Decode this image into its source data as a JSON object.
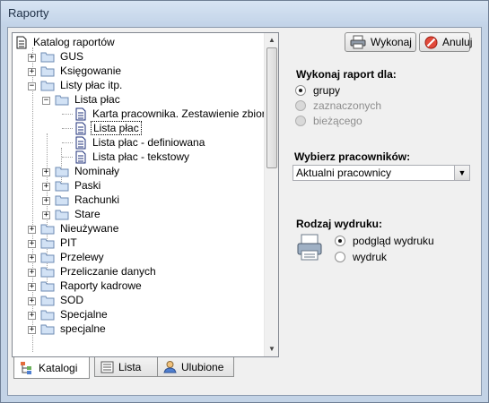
{
  "window": {
    "title": "Raporty"
  },
  "toolbar": {
    "execute_label": "Wykonaj",
    "cancel_label": "Anuluj"
  },
  "tree": {
    "root": "Katalog raportów",
    "items": [
      {
        "label": "GUS"
      },
      {
        "label": "Księgowanie"
      },
      {
        "label": "Listy płac itp."
      },
      {
        "label": "Lista płac"
      },
      {
        "label": "Karta pracownika. Zestawienie zbiorcze"
      },
      {
        "label": "Lista płac"
      },
      {
        "label": "Lista płac - definiowana"
      },
      {
        "label": "Lista płac - tekstowy"
      },
      {
        "label": "Nominały"
      },
      {
        "label": "Paski"
      },
      {
        "label": "Rachunki"
      },
      {
        "label": "Stare"
      },
      {
        "label": "Nieużywane"
      },
      {
        "label": "PIT"
      },
      {
        "label": "Przelewy"
      },
      {
        "label": "Przeliczanie danych"
      },
      {
        "label": "Raporty kadrowe"
      },
      {
        "label": "SOD"
      },
      {
        "label": "Specjalne"
      },
      {
        "label": "specjalne"
      }
    ]
  },
  "tabs": [
    {
      "label": "Katalogi"
    },
    {
      "label": "Lista"
    },
    {
      "label": "Ulubione"
    }
  ],
  "report_for": {
    "title": "Wykonaj raport dla:",
    "options": [
      {
        "label": "grupy"
      },
      {
        "label": "zaznaczonych"
      },
      {
        "label": "bieżącego"
      }
    ]
  },
  "employees": {
    "title": "Wybierz pracowników:",
    "value": "Aktualni pracownicy"
  },
  "print_type": {
    "title": "Rodzaj wydruku:",
    "options": [
      {
        "label": "podgląd wydruku"
      },
      {
        "label": "wydruk"
      }
    ]
  }
}
